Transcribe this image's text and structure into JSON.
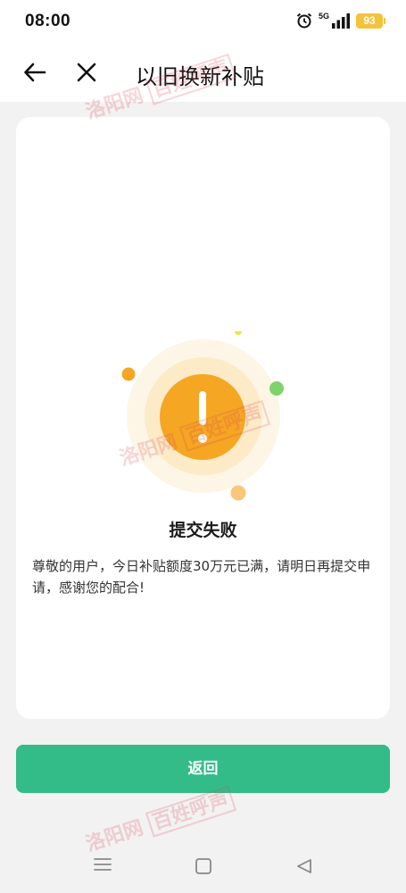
{
  "status_bar": {
    "time": "08:00",
    "network": "5G",
    "battery": "93",
    "icons": [
      "alarm-icon",
      "signal-icon",
      "battery-icon"
    ]
  },
  "nav": {
    "title": "以旧换新补贴",
    "icons": [
      "back-arrow-icon",
      "close-icon"
    ]
  },
  "result": {
    "title": "提交失败",
    "message": "尊敬的用户，今日补贴额度30万元已满，请明日再提交申请，感谢您的配合!",
    "icon": "exclamation-warning-icon",
    "accent_color": "#f5a623"
  },
  "actions": {
    "return_label": "返回",
    "button_color": "#33bb88"
  },
  "system_nav": {
    "icons": [
      "menu-icon",
      "home-icon",
      "back-triangle-icon"
    ]
  },
  "watermarks": {
    "site": "洛阳网",
    "column": "百姓呼声"
  }
}
